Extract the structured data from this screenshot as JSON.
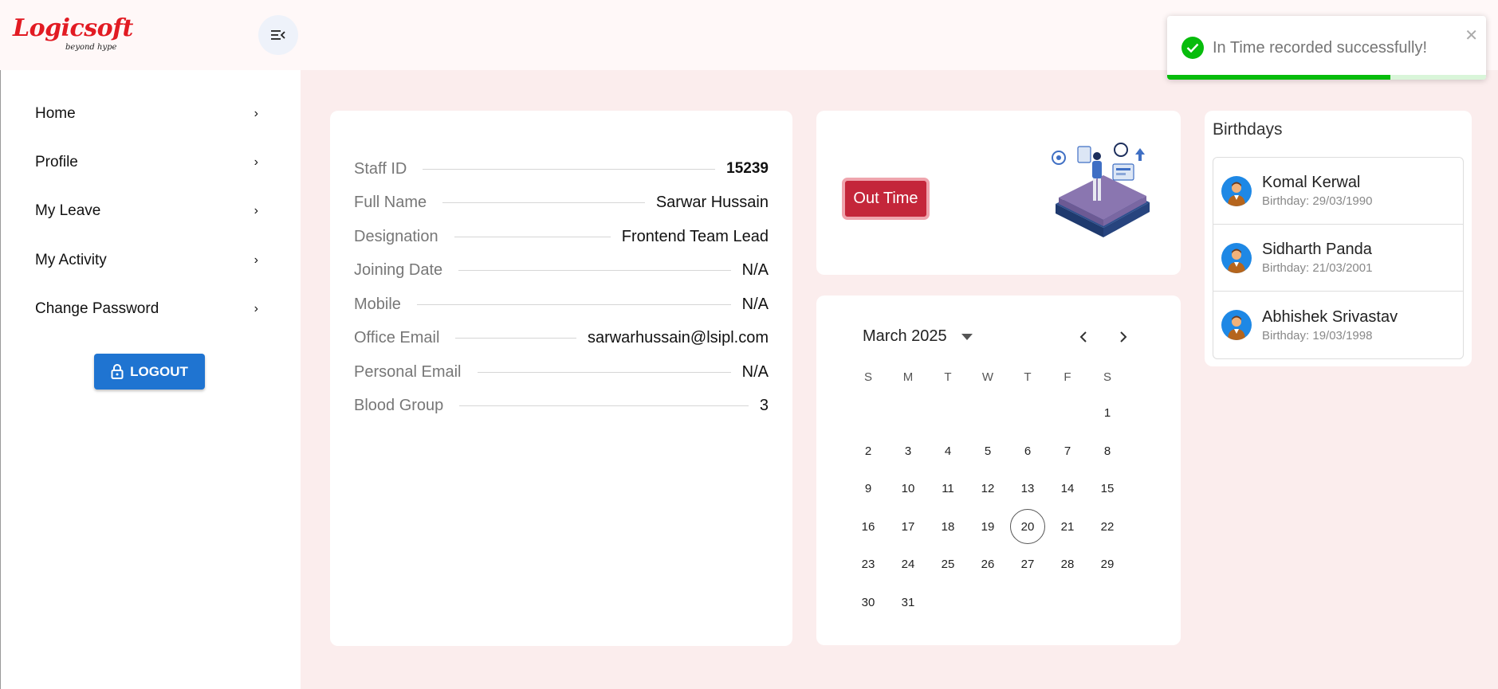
{
  "brand": {
    "name": "Logicsoft",
    "tagline": "beyond hype"
  },
  "header": {
    "menu_toggle_icon": "menu-collapse-icon"
  },
  "sidebar": {
    "items": [
      {
        "label": "Home",
        "icon": "chevron-right-icon"
      },
      {
        "label": "Profile",
        "icon": "chevron-right-icon"
      },
      {
        "label": "My Leave",
        "icon": "chevron-right-icon"
      },
      {
        "label": "My Activity",
        "icon": "chevron-right-icon"
      },
      {
        "label": "Change Password",
        "icon": "chevron-right-icon"
      }
    ],
    "logout_label": "LOGOUT",
    "logout_icon": "lock-icon",
    "logout_color": "#1f74d1"
  },
  "profile": {
    "rows": [
      {
        "label": "Staff ID",
        "value": "15239"
      },
      {
        "label": "Full Name",
        "value": "Sarwar Hussain"
      },
      {
        "label": "Designation",
        "value": "Frontend Team Lead"
      },
      {
        "label": "Joining Date",
        "value": "N/A"
      },
      {
        "label": "Mobile",
        "value": "N/A"
      },
      {
        "label": "Office Email",
        "value": "sarwarhussain@lsipl.com"
      },
      {
        "label": "Personal Email",
        "value": "N/A"
      },
      {
        "label": "Blood Group",
        "value": "3"
      }
    ]
  },
  "attendance": {
    "button_label": "Out Time",
    "button_color": "#c4263a"
  },
  "calendar": {
    "month_label": "March 2025",
    "weekdays": [
      "S",
      "M",
      "T",
      "W",
      "T",
      "F",
      "S"
    ],
    "weeks": [
      [
        "",
        "",
        "",
        "",
        "",
        "",
        "1"
      ],
      [
        "2",
        "3",
        "4",
        "5",
        "6",
        "7",
        "8"
      ],
      [
        "9",
        "10",
        "11",
        "12",
        "13",
        "14",
        "15"
      ],
      [
        "16",
        "17",
        "18",
        "19",
        "20",
        "21",
        "22"
      ],
      [
        "23",
        "24",
        "25",
        "26",
        "27",
        "28",
        "29"
      ],
      [
        "30",
        "31",
        "",
        "",
        "",
        "",
        ""
      ]
    ],
    "today": "20"
  },
  "birthdays": {
    "title": "Birthdays",
    "items": [
      {
        "name": "Komal Kerwal",
        "date": "Birthday: 29/03/1990"
      },
      {
        "name": "Sidharth Panda",
        "date": "Birthday: 21/03/2001"
      },
      {
        "name": "Abhishek Srivastav",
        "date": "Birthday: 19/03/1998"
      }
    ]
  },
  "toast": {
    "message": "In Time recorded successfully!",
    "icon": "check-circle-icon",
    "close_icon": "close-icon",
    "progress_percent": 70,
    "color": "#07bc0c"
  }
}
